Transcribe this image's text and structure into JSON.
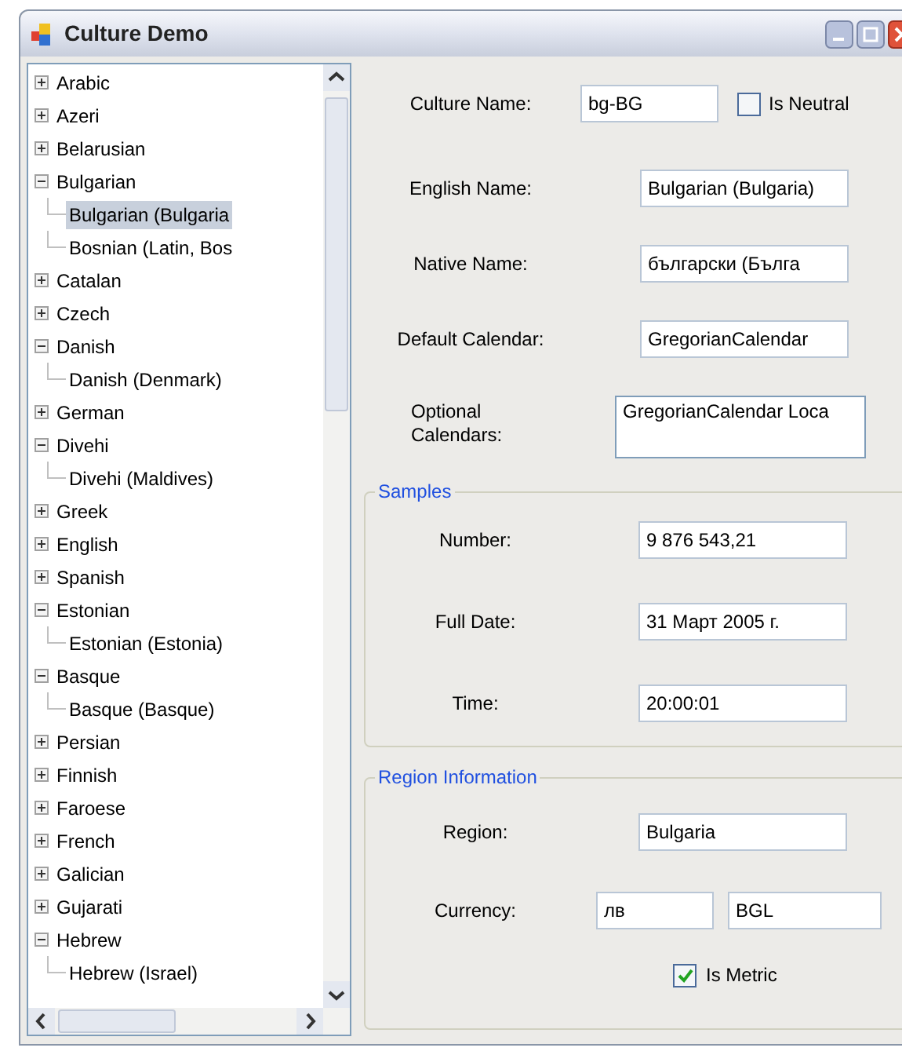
{
  "window": {
    "title": "Culture Demo"
  },
  "tree": {
    "items": [
      {
        "label": "Arabic",
        "expanded": false,
        "selected": false
      },
      {
        "label": "Azeri",
        "expanded": false,
        "selected": false
      },
      {
        "label": "Belarusian",
        "expanded": false,
        "selected": false
      },
      {
        "label": "Bulgarian",
        "expanded": true,
        "selected": false,
        "children": [
          {
            "label": "Bulgarian (Bulgaria",
            "selected": true
          },
          {
            "label": "Bosnian (Latin, Bos",
            "selected": false
          }
        ]
      },
      {
        "label": "Catalan",
        "expanded": false,
        "selected": false
      },
      {
        "label": "Czech",
        "expanded": false,
        "selected": false
      },
      {
        "label": "Danish",
        "expanded": true,
        "selected": false,
        "children": [
          {
            "label": "Danish (Denmark)",
            "selected": false
          }
        ]
      },
      {
        "label": "German",
        "expanded": false,
        "selected": false
      },
      {
        "label": "Divehi",
        "expanded": true,
        "selected": false,
        "children": [
          {
            "label": "Divehi (Maldives)",
            "selected": false
          }
        ]
      },
      {
        "label": "Greek",
        "expanded": false,
        "selected": false
      },
      {
        "label": "English",
        "expanded": false,
        "selected": false
      },
      {
        "label": "Spanish",
        "expanded": false,
        "selected": false
      },
      {
        "label": "Estonian",
        "expanded": true,
        "selected": false,
        "children": [
          {
            "label": "Estonian (Estonia)",
            "selected": false
          }
        ]
      },
      {
        "label": "Basque",
        "expanded": true,
        "selected": false,
        "children": [
          {
            "label": "Basque (Basque)",
            "selected": false
          }
        ]
      },
      {
        "label": "Persian",
        "expanded": false,
        "selected": false
      },
      {
        "label": "Finnish",
        "expanded": false,
        "selected": false
      },
      {
        "label": "Faroese",
        "expanded": false,
        "selected": false
      },
      {
        "label": "French",
        "expanded": false,
        "selected": false
      },
      {
        "label": "Galician",
        "expanded": false,
        "selected": false
      },
      {
        "label": "Gujarati",
        "expanded": false,
        "selected": false
      },
      {
        "label": "Hebrew",
        "expanded": true,
        "selected": false,
        "children": [
          {
            "label": "Hebrew (Israel)",
            "selected": false
          }
        ]
      }
    ]
  },
  "culture": {
    "fields": [
      {
        "kind": "check",
        "label": "Culture Name:",
        "value": "bg-BG",
        "checkbox": {
          "label": "Is Neutral",
          "checked": false
        }
      },
      {
        "kind": "text",
        "label": "English Name:",
        "value": "Bulgarian (Bulgaria)"
      },
      {
        "kind": "text",
        "label": "Native Name:",
        "value": "български (Бълга"
      },
      {
        "kind": "text",
        "label": "Default Calendar:",
        "value": "GregorianCalendar"
      },
      {
        "kind": "multiline",
        "label": "Optional Calendars:",
        "value": "GregorianCalendar Loca"
      }
    ]
  },
  "samples": {
    "title": "Samples",
    "fields": [
      {
        "label": "Number:",
        "value": "9 876 543,21"
      },
      {
        "label": "Full Date:",
        "value": "31 Март 2005 г."
      },
      {
        "label": "Time:",
        "value": "20:00:01"
      }
    ]
  },
  "region": {
    "title": "Region Information",
    "region": {
      "label": "Region:",
      "value": "Bulgaria"
    },
    "currency": {
      "label": "Currency:",
      "values": [
        "лв",
        "BGL"
      ]
    },
    "metric": {
      "label": "Is Metric",
      "checked": true
    }
  }
}
